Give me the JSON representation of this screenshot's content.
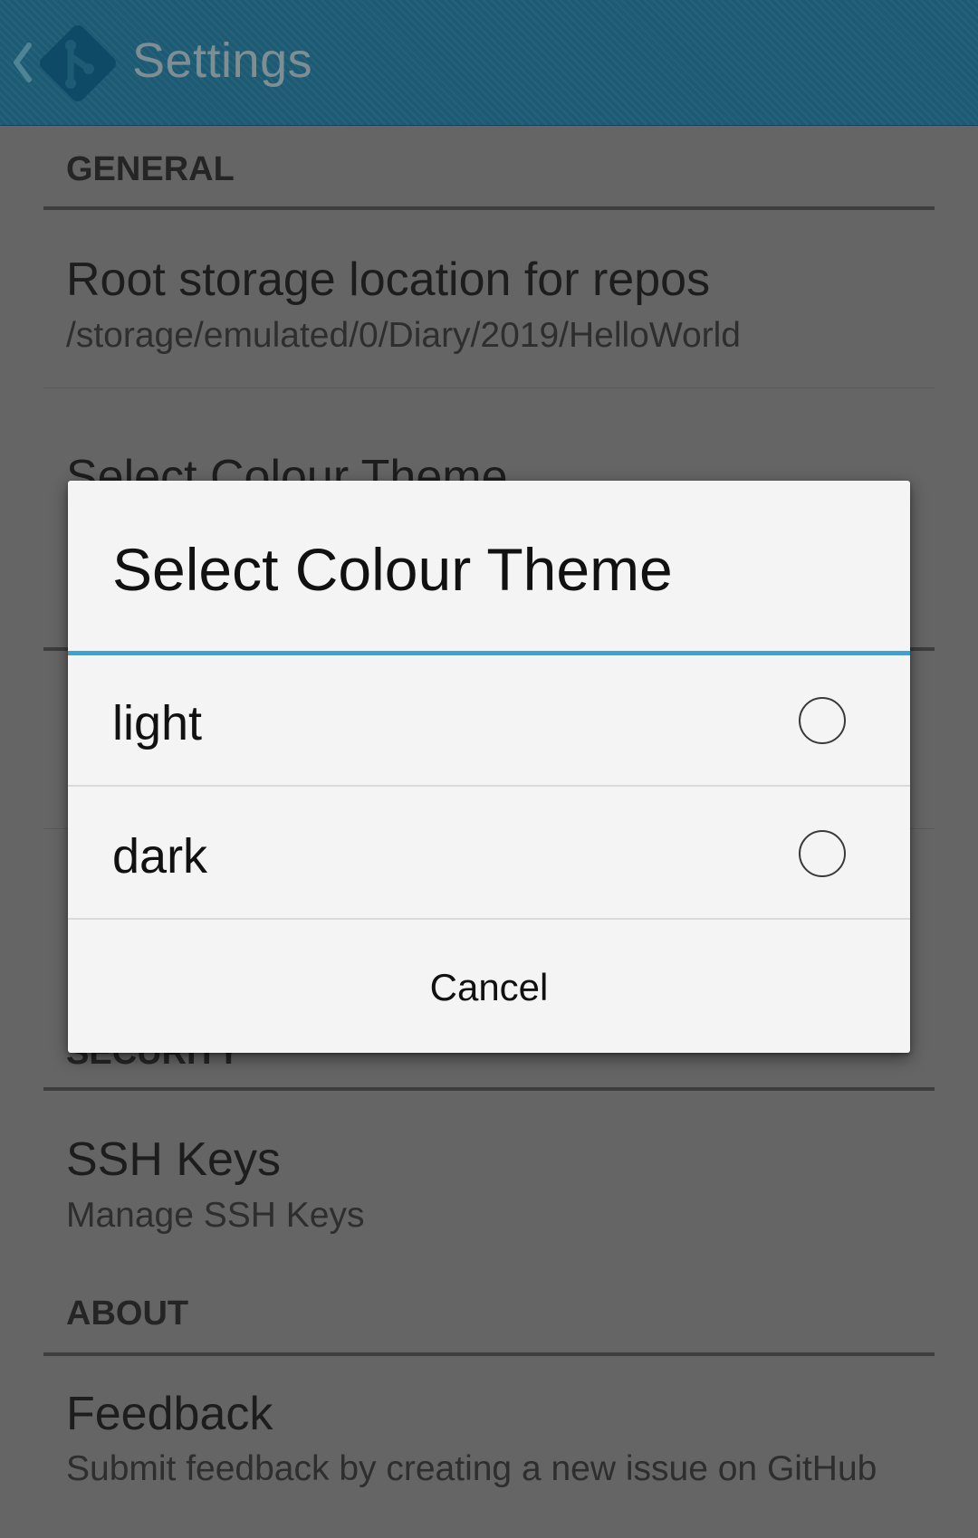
{
  "action_bar": {
    "title": "Settings",
    "background_color": "#1c5b73",
    "up_icon": "chevron-left-icon",
    "logo_icon": "git-logo-icon"
  },
  "settings": {
    "general_header": "GENERAL",
    "root_storage": {
      "title": "Root storage location for repos",
      "summary": "/storage/emulated/0/Diary/2019/HelloWorld"
    },
    "colour_theme_partial_title": "Select Colour Theme",
    "security_header_partial": "SECURITY",
    "ssh_keys": {
      "title": "SSH Keys",
      "summary": "Manage SSH Keys"
    },
    "about_header": "ABOUT",
    "feedback": {
      "title": "Feedback",
      "summary": "Submit feedback by creating a new issue on GitHub"
    }
  },
  "dialog": {
    "title": "Select Colour Theme",
    "accent_color": "#33a6d8",
    "options": [
      {
        "label": "light",
        "selected": false
      },
      {
        "label": "dark",
        "selected": false
      }
    ],
    "cancel_label": "Cancel"
  }
}
